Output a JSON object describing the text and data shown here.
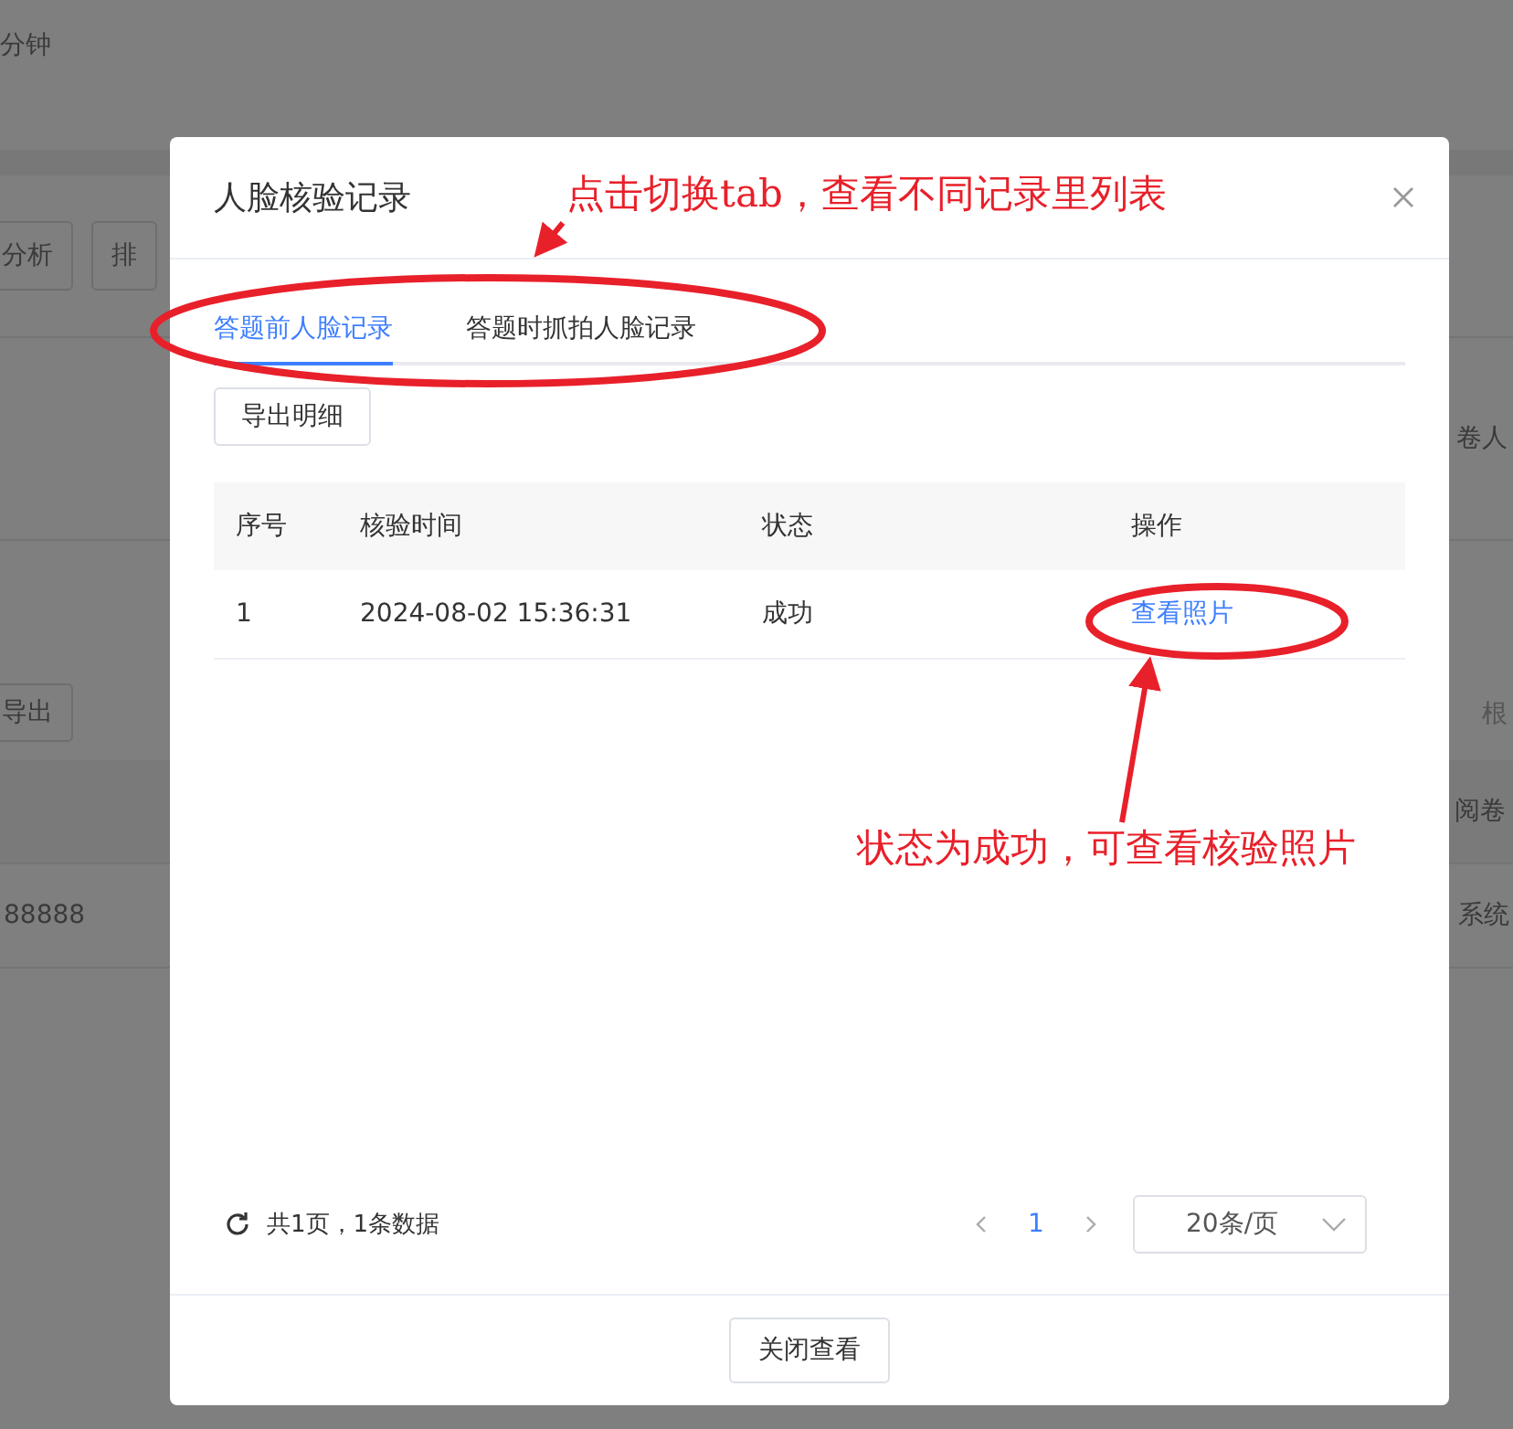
{
  "background": {
    "top_text": "分钟",
    "toolbar_buttons": [
      "分析",
      "排"
    ],
    "export_button": "导出",
    "row_cell": "88888",
    "right_texts": [
      "卷人",
      "根",
      "阅卷",
      "系统"
    ]
  },
  "dialog": {
    "title": "人脸核验记录",
    "tabs": [
      {
        "label": "答题前人脸记录",
        "selected": true
      },
      {
        "label": "答题时抓拍人脸记录",
        "selected": false
      }
    ],
    "export_button": "导出明细",
    "table": {
      "columns": [
        "序号",
        "核验时间",
        "状态",
        "操作"
      ],
      "rows": [
        {
          "index": "1",
          "time": "2024-08-02 15:36:31",
          "status": "成功",
          "action": "查看照片"
        }
      ]
    },
    "pagination": {
      "summary": "共1页，1条数据",
      "pages": [
        {
          "label": "1",
          "selected": true
        }
      ],
      "page_size": "20条/页"
    },
    "close_button": "关闭查看"
  },
  "annotations": [
    {
      "text": "点击切换tab，查看不同记录里列表"
    },
    {
      "text": "状态为成功，可查看核验照片"
    }
  ]
}
